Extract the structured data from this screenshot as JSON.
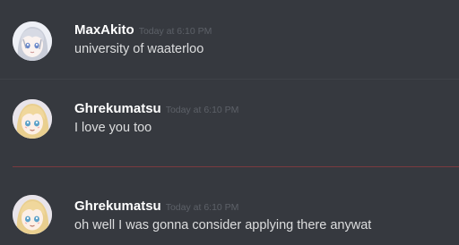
{
  "messages": [
    {
      "author": "MaxAkito",
      "timestamp": "Today at 6:10 PM",
      "content": "university of waaterloo",
      "avatar_icon": "silver-haired-anime-avatar"
    },
    {
      "author": "Ghrekumatsu",
      "timestamp": "Today at 6:10 PM",
      "content": "I love you too",
      "avatar_icon": "blonde-anime-girl-avatar"
    },
    {
      "author": "Ghrekumatsu",
      "timestamp": "Today at 6:10 PM",
      "content": "oh well I was gonna consider applying there anywat",
      "avatar_icon": "blonde-anime-girl-avatar"
    }
  ],
  "colors": {
    "background": "#36393f",
    "author": "#ffffff",
    "message_text": "#dcddde",
    "timestamp": "#5d6168",
    "new_messages_divider": "#7a3a3f"
  }
}
